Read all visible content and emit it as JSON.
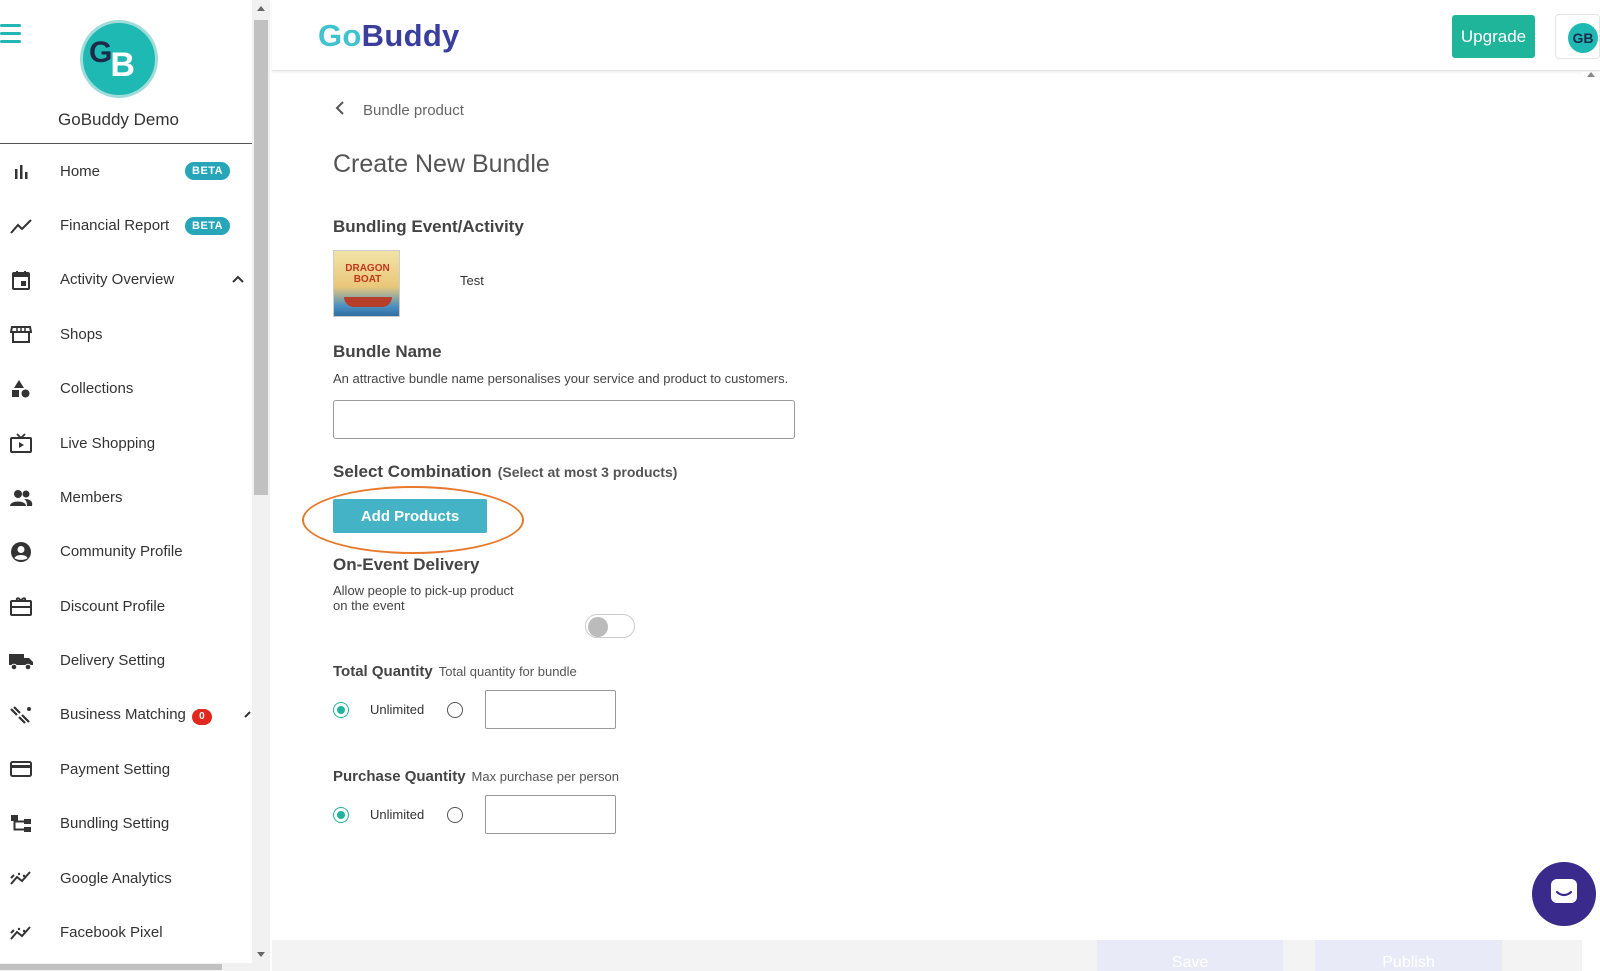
{
  "sidebar": {
    "org_name": "GoBuddy Demo",
    "avatar_initials": "GB",
    "items": [
      {
        "label": "Home",
        "badge": "BETA",
        "icon": "bar-chart-icon"
      },
      {
        "label": "Financial Report",
        "badge": "BETA",
        "icon": "trend-line-icon"
      },
      {
        "label": "Activity Overview",
        "icon": "calendar-icon",
        "expanded": true
      },
      {
        "label": "Shops",
        "icon": "store-icon"
      },
      {
        "label": "Collections",
        "icon": "shapes-icon"
      },
      {
        "label": "Live Shopping",
        "icon": "live-tv-icon"
      },
      {
        "label": "Members",
        "icon": "people-icon"
      },
      {
        "label": "Community Profile",
        "icon": "account-circle-icon"
      },
      {
        "label": "Discount Profile",
        "icon": "gift-card-icon"
      },
      {
        "label": "Delivery Setting",
        "icon": "truck-icon"
      },
      {
        "label": "Business Matching",
        "count": "0",
        "icon": "handshake-icon"
      },
      {
        "label": "Payment Setting",
        "icon": "credit-card-icon"
      },
      {
        "label": "Bundling Setting",
        "icon": "hierarchy-icon"
      },
      {
        "label": "Google Analytics",
        "icon": "analytics-icon"
      },
      {
        "label": "Facebook Pixel",
        "icon": "analytics-icon"
      }
    ]
  },
  "header": {
    "logo_part1": "Go",
    "logo_part2": "Buddy",
    "upgrade_label": "Upgrade",
    "avatar_initials": "GB"
  },
  "main": {
    "breadcrumb": "Bundle product",
    "title": "Create New Bundle",
    "event_section_title": "Bundling Event/Activity",
    "event": {
      "thumb_text": "DRAGON BOAT",
      "name": "Test"
    },
    "bundle_name": {
      "title": "Bundle Name",
      "description": "An attractive bundle name personalises your service and product to customers.",
      "value": ""
    },
    "combination": {
      "title": "Select Combination",
      "subtitle": "(Select at most 3 products)",
      "add_button": "Add Products"
    },
    "delivery": {
      "title": "On-Event Delivery",
      "description_line1": "Allow people to pick-up product",
      "description_line2": "on the event",
      "enabled": false
    },
    "total_quantity": {
      "title": "Total Quantity",
      "subtitle": "Total quantity for bundle",
      "unlimited_label": "Unlimited",
      "selected": "unlimited"
    },
    "purchase_quantity": {
      "title": "Purchase Quantity",
      "subtitle": "Max purchase per person",
      "unlimited_label": "Unlimited",
      "selected": "unlimited"
    },
    "footer": {
      "save_label": "Save",
      "publish_label": "Publish"
    }
  },
  "colors": {
    "accent_teal": "#1fb59a",
    "button_blue": "#44b3c5",
    "logo_go": "#41c3cf",
    "logo_buddy": "#3a3f9e",
    "highlight": "#e8782a",
    "chat": "#3a2a8c"
  }
}
